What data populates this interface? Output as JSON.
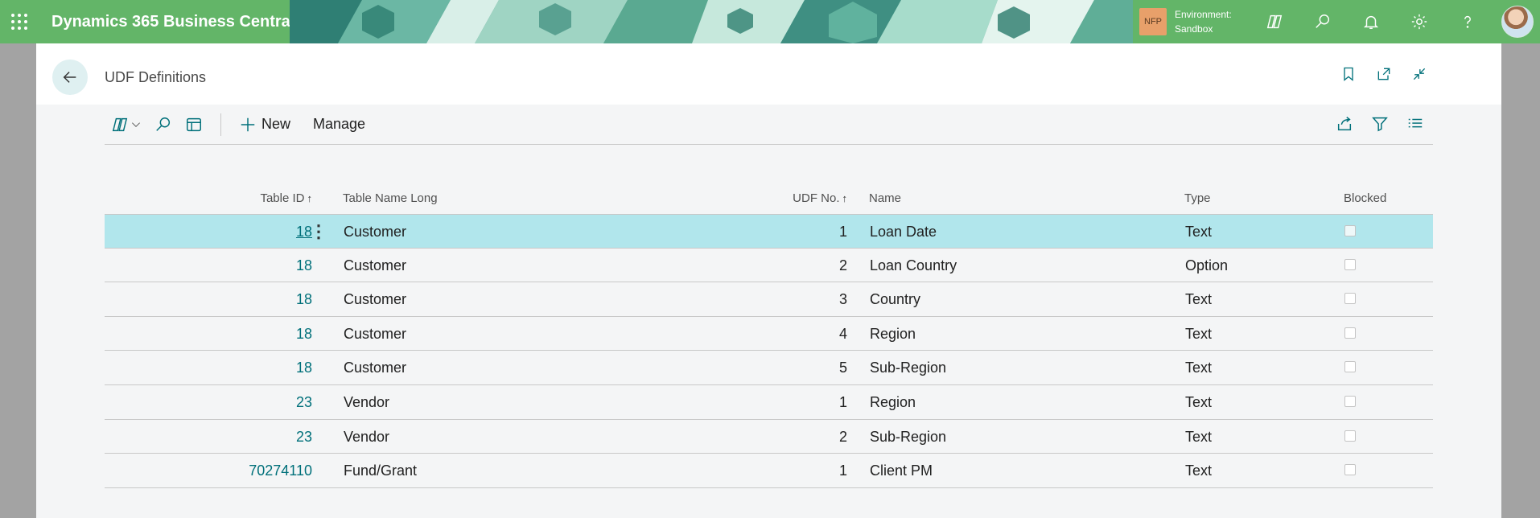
{
  "topbar": {
    "app_name": "Dynamics 365 Business Central",
    "env_badge": "NFP",
    "env_label": "Environment:",
    "env_name": "Sandbox"
  },
  "page": {
    "title": "UDF Definitions"
  },
  "actionbar": {
    "new_label": "New",
    "manage_label": "Manage"
  },
  "table": {
    "headers": {
      "table_id": "Table ID",
      "table_name_long": "Table Name Long",
      "udf_no": "UDF No.",
      "name": "Name",
      "type": "Type",
      "blocked": "Blocked"
    },
    "sort_arrow": "↑",
    "rows": [
      {
        "table_id": "18",
        "table_name_long": "Customer",
        "udf_no": "1",
        "name": "Loan Date",
        "type": "Text",
        "blocked": false
      },
      {
        "table_id": "18",
        "table_name_long": "Customer",
        "udf_no": "2",
        "name": "Loan Country",
        "type": "Option",
        "blocked": false
      },
      {
        "table_id": "18",
        "table_name_long": "Customer",
        "udf_no": "3",
        "name": "Country",
        "type": "Text",
        "blocked": false
      },
      {
        "table_id": "18",
        "table_name_long": "Customer",
        "udf_no": "4",
        "name": "Region",
        "type": "Text",
        "blocked": false
      },
      {
        "table_id": "18",
        "table_name_long": "Customer",
        "udf_no": "5",
        "name": "Sub-Region",
        "type": "Text",
        "blocked": false
      },
      {
        "table_id": "23",
        "table_name_long": "Vendor",
        "udf_no": "1",
        "name": "Region",
        "type": "Text",
        "blocked": false
      },
      {
        "table_id": "23",
        "table_name_long": "Vendor",
        "udf_no": "2",
        "name": "Sub-Region",
        "type": "Text",
        "blocked": false
      },
      {
        "table_id": "70274110",
        "table_name_long": "Fund/Grant",
        "udf_no": "1",
        "name": "Client PM",
        "type": "Text",
        "blocked": false
      }
    ],
    "row_menu_glyph": "⋮"
  },
  "colors": {
    "topbar": "#63b568",
    "accent": "#00707a",
    "selected_row": "#b1e6ec"
  }
}
